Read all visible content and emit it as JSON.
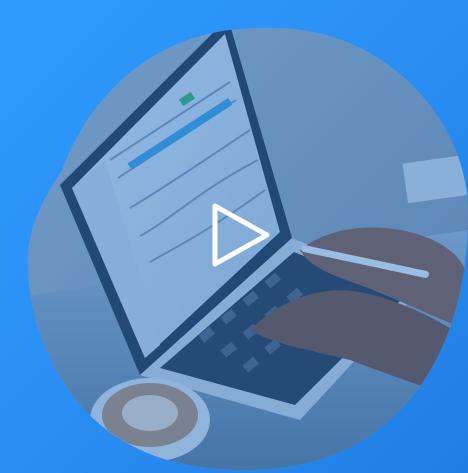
{
  "background": {
    "gradient_start": "#2f9bff",
    "gradient_end": "#1f7ee4"
  },
  "thumbnail": {
    "shape": "blob",
    "tint": "#1a6fcc",
    "description_icon": "laptop-typing-image"
  },
  "play_button": {
    "icon": "play-triangle-icon",
    "color": "#ffffff"
  }
}
